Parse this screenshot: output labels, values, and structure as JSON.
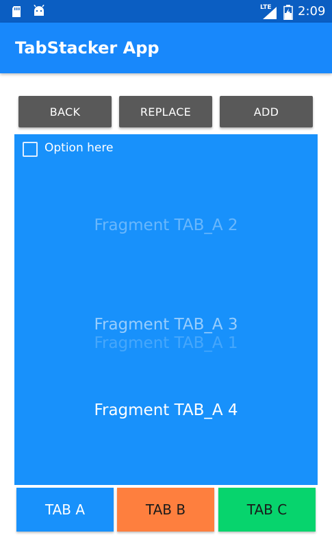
{
  "status_bar": {
    "network_label": "LTE",
    "time": "2:09",
    "icons": [
      "sd-card-icon",
      "android-icon",
      "signal-icon",
      "battery-charging-icon"
    ]
  },
  "app_bar": {
    "title": "TabStacker App"
  },
  "toolbar": {
    "back_label": "BACK",
    "replace_label": "REPLACE",
    "add_label": "ADD"
  },
  "fragment": {
    "checkbox_label": "Option here",
    "checkbox_checked": false,
    "stacked_fragments": [
      "Fragment TAB_A 2",
      "Fragment TAB_A 3",
      "Fragment TAB_A 1",
      "Fragment TAB_A 4"
    ]
  },
  "tabs": [
    {
      "label": "TAB A",
      "color": "#1891fb"
    },
    {
      "label": "TAB B",
      "color": "#fe7f3e"
    },
    {
      "label": "TAB C",
      "color": "#07d46d"
    }
  ],
  "colors": {
    "status_bar": "#0b5ec2",
    "app_bar": "#1888fb",
    "button": "#595959",
    "fragment_bg": "#1891fb"
  }
}
